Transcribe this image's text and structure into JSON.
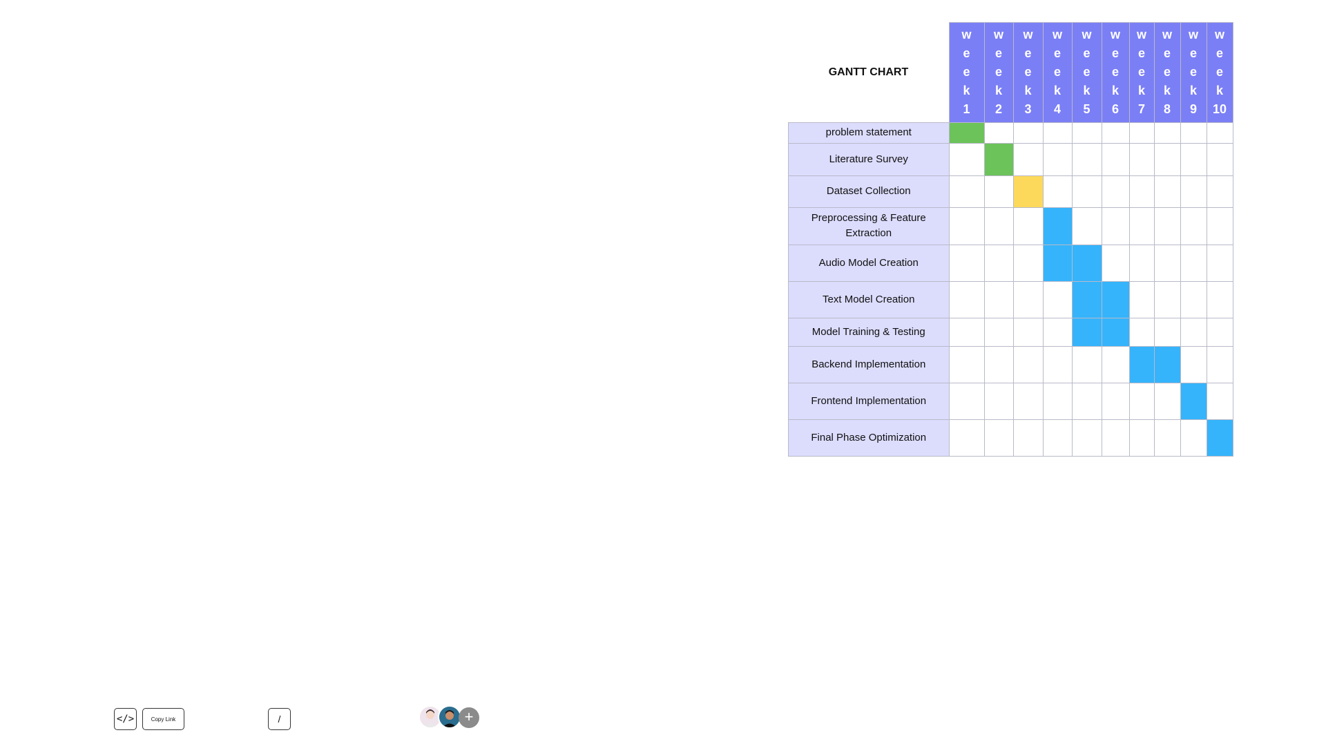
{
  "gantt": {
    "title": "GANTT CHART",
    "weeks": [
      {
        "label": "week1",
        "bold": true
      },
      {
        "label": "week2",
        "bold": false
      },
      {
        "label": "week3",
        "bold": true
      },
      {
        "label": "week4",
        "bold": true
      },
      {
        "label": "week5",
        "bold": true
      },
      {
        "label": "week6",
        "bold": false
      },
      {
        "label": "week7",
        "bold": true
      },
      {
        "label": "week8",
        "bold": false
      },
      {
        "label": "week9",
        "bold": true
      },
      {
        "label": "week10",
        "bold": true
      }
    ],
    "tasks": [
      {
        "label": "problem statement",
        "weeks": [
          1
        ],
        "color": "green"
      },
      {
        "label": "Literature Survey",
        "weeks": [
          2
        ],
        "color": "green"
      },
      {
        "label": "Dataset Collection",
        "weeks": [
          3
        ],
        "color": "yellow"
      },
      {
        "label": "Preprocessing & Feature Extraction",
        "weeks": [
          4
        ],
        "color": "blue"
      },
      {
        "label": "Audio Model Creation",
        "weeks": [
          4,
          5
        ],
        "color": "blue"
      },
      {
        "label": "Text Model Creation",
        "weeks": [
          5,
          6
        ],
        "color": "blue"
      },
      {
        "label": "Model Training & Testing",
        "weeks": [
          5,
          6
        ],
        "color": "blue"
      },
      {
        "label": "Backend Implementation",
        "weeks": [
          7,
          8
        ],
        "color": "blue"
      },
      {
        "label": "Frontend Implementation",
        "weeks": [
          9
        ],
        "color": "blue"
      },
      {
        "label": "Final Phase Optimization",
        "weeks": [
          10
        ],
        "color": "blue"
      }
    ],
    "colors": {
      "header": "#7b7ff5",
      "task_bg": "#dcdcfd",
      "green": "#6cc35a",
      "yellow": "#fcd95b",
      "blue": "#35b4fb"
    }
  },
  "toolbar": {
    "embed_label": "</>",
    "copy_link_label": "Copy Link",
    "slash_label": "/",
    "add_label": "+",
    "avatars": [
      "avatar-user-1",
      "avatar-user-2"
    ]
  }
}
